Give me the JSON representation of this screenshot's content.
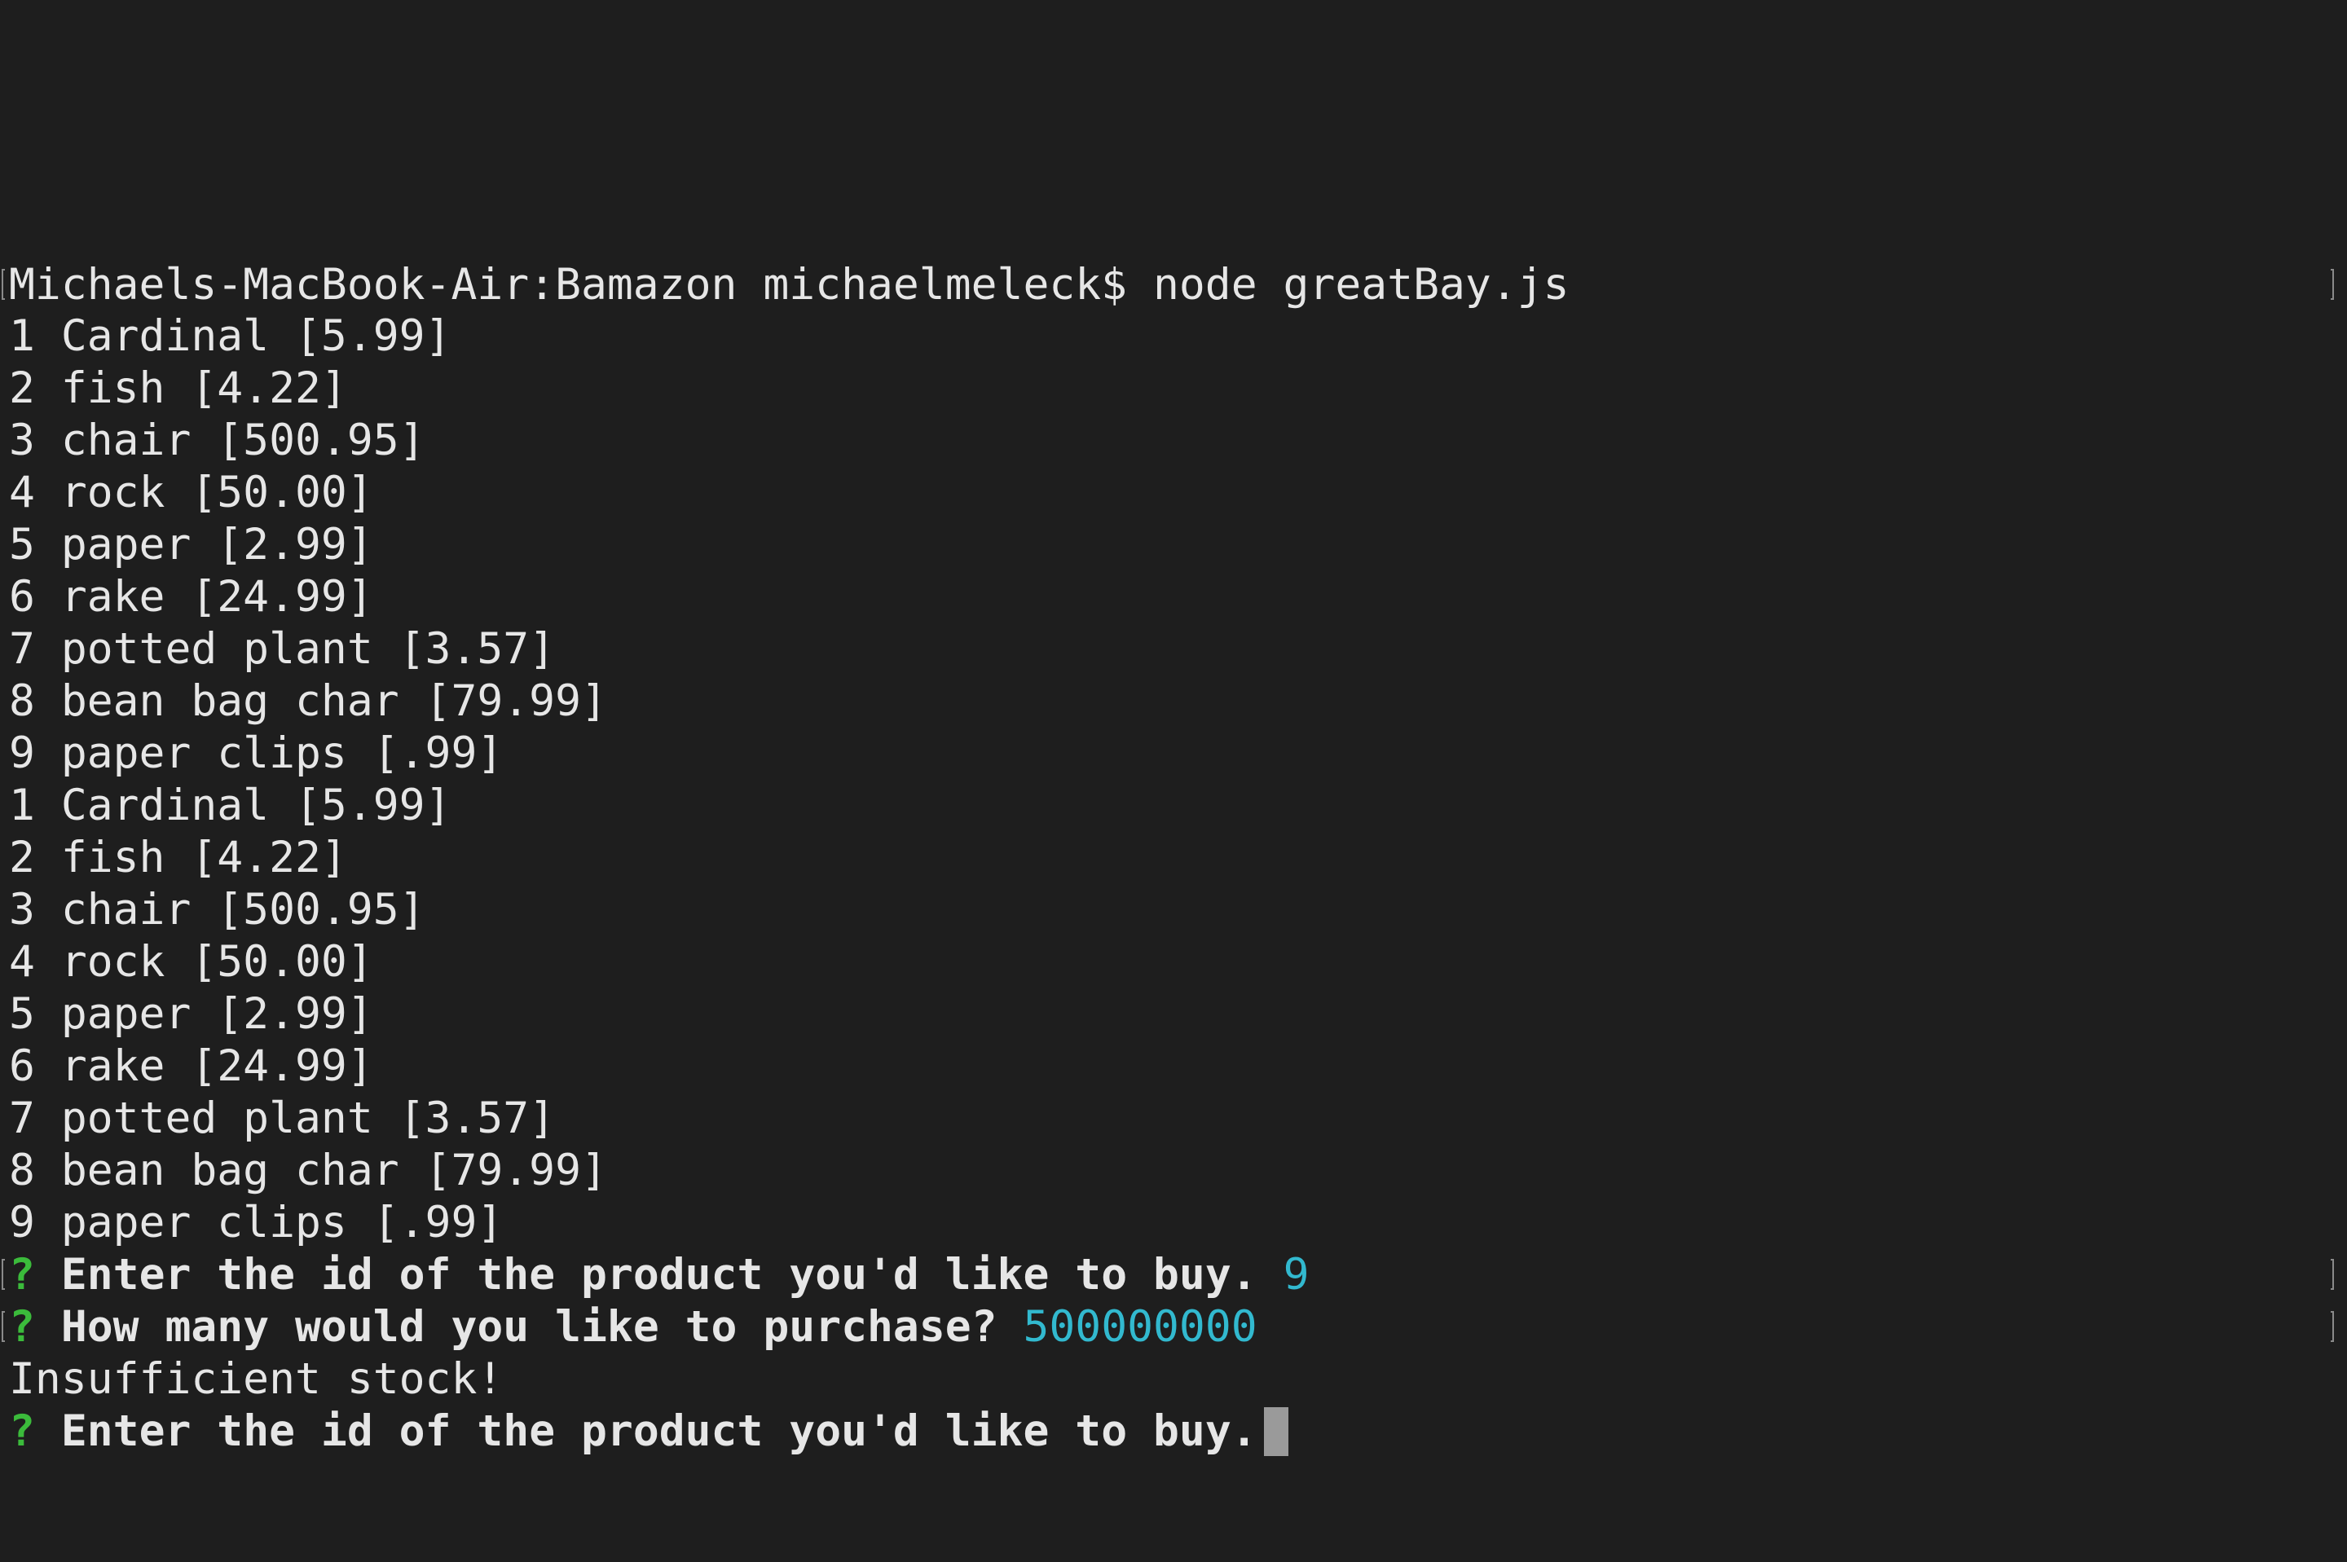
{
  "terminal": {
    "command_line": "Michaels-MacBook-Air:Bamazon michaelmeleck$ node greatBay.js",
    "product_list_first": [
      "1 Cardinal [5.99]",
      "2 fish [4.22]",
      "3 chair [500.95]",
      "4 rock [50.00]",
      "5 paper [2.99]",
      "6 rake [24.99]",
      "7 potted plant [3.57]",
      "8 bean bag char [79.99]",
      "9 paper clips [.99]"
    ],
    "product_list_second": [
      "1 Cardinal [5.99]",
      "2 fish [4.22]",
      "3 chair [500.95]",
      "4 rock [50.00]",
      "5 paper [2.99]",
      "6 rake [24.99]",
      "7 potted plant [3.57]",
      "8 bean bag char [79.99]",
      "9 paper clips [.99]"
    ],
    "prompt_marker": "?",
    "prompt_id_question": "Enter the id of the product you'd like to buy.",
    "prompt_id_answer": "9",
    "prompt_qty_question": "How many would you like to purchase?",
    "prompt_qty_answer": "500000000",
    "message": "Insufficient stock!",
    "prompt_id_question_2": "Enter the id of the product you'd like to buy.",
    "colors": {
      "background": "#1e1e1e",
      "text": "#e6e6e6",
      "prompt_marker": "#3bbb3b",
      "answer": "#32b9cf",
      "cursor": "#9a9a9a"
    }
  }
}
